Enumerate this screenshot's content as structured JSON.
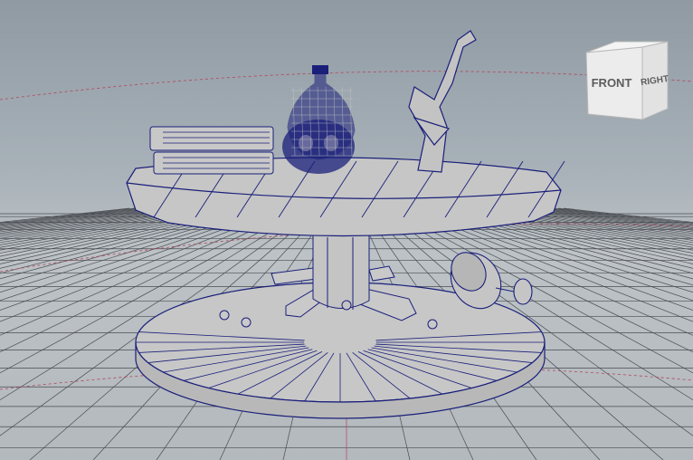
{
  "viewport": {
    "background_top": "#8f9aa3",
    "background_bottom": "#b3b9bd",
    "grid_color": "#4a4d52",
    "grid_axis_color": "#b3455c",
    "wireframe_color": "#1a1f7a",
    "shaded_color": "#c8c8c8"
  },
  "viewcube": {
    "front_label": "FRONT",
    "right_label": "RIGHT",
    "face_color": "#e9e9e9",
    "icon": "view-cube-icon"
  },
  "scene_objects": [
    {
      "name": "round-table",
      "icon": "table-mesh"
    },
    {
      "name": "book-stack",
      "icon": "books-mesh"
    },
    {
      "name": "potion-bottle",
      "icon": "bottle-mesh"
    },
    {
      "name": "skull",
      "icon": "skull-mesh"
    },
    {
      "name": "candle-holder",
      "icon": "candle-holder-mesh"
    },
    {
      "name": "goblet",
      "icon": "goblet-mesh"
    }
  ]
}
